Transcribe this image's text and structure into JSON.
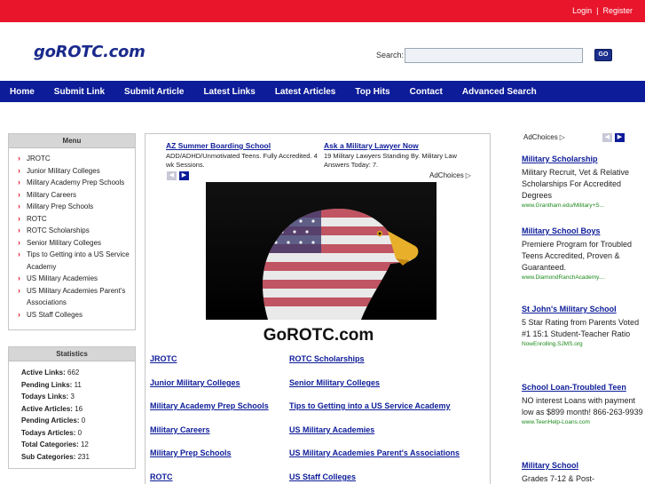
{
  "header": {
    "login_label": "Login",
    "separator": "|",
    "register_label": "Register",
    "logo_text": "goROTC.com",
    "search_label": "Search:",
    "search_value": "",
    "search_button_label": "GO"
  },
  "nav": {
    "items": [
      "Home",
      "Submit Link",
      "Submit Article",
      "Latest Links",
      "Latest Articles",
      "Top Hits",
      "Contact",
      "Advanced Search"
    ]
  },
  "menu": {
    "title": "Menu",
    "items": [
      "JROTC",
      "Junior Military Colleges",
      "Military Academy Prep Schools",
      "Military Careers",
      "Military Prep Schools",
      "ROTC",
      "ROTC Scholarships",
      "Senior Military Colleges",
      "Tips to Getting into a US Service Academy",
      "US Military Academies",
      "US Military Academies Parent's Associations",
      "US Staff Colleges"
    ]
  },
  "stats": {
    "title": "Statistics",
    "rows": [
      {
        "label": "Active Links:",
        "value": "662"
      },
      {
        "label": "Pending Links:",
        "value": "11"
      },
      {
        "label": "Todays Links:",
        "value": "3"
      },
      {
        "label": "Active Articles:",
        "value": "16"
      },
      {
        "label": "Pending Articles:",
        "value": "0"
      },
      {
        "label": "Todays Articles:",
        "value": "0"
      },
      {
        "label": "Total Categories:",
        "value": "12"
      },
      {
        "label": "Sub Categories:",
        "value": "231"
      }
    ]
  },
  "center_ads": {
    "ad1_title": "AZ Summer Boarding School",
    "ad1_text": "ADD/ADHD/Unmotivated Teens. Fully Accredited. 4 wk Sessions.",
    "ad2_title": "Ask a Military Lawyer Now",
    "ad2_text": "19 Military Lawyers Standing By. Military Law Answers Today: 7.",
    "adchoices_label": "AdChoices",
    "prev_arrow": "◀",
    "next_arrow": "▶"
  },
  "main": {
    "site_title": "GoROTC.com",
    "hero_icon": "eagle-flag-image"
  },
  "categories": {
    "left": [
      "JROTC",
      "Junior Military Colleges",
      "Military Academy Prep Schools",
      "Military Careers",
      "Military Prep Schools",
      "ROTC"
    ],
    "right": [
      "ROTC Scholarships",
      "Senior Military Colleges",
      "Tips to Getting into a US Service Academy",
      "US Military Academies",
      "US Military Academies Parent's Associations",
      "US Staff Colleges"
    ]
  },
  "right_ads": {
    "adchoices_label": "AdChoices",
    "ads": [
      {
        "title": "Military Scholarship",
        "text": "Military Recruit, Vet & Relative Scholarships For Accredited Degrees",
        "url": "www.Grantham.edu/Military+S..."
      },
      {
        "title": "Military School Boys",
        "text": "Premiere Program for Troubled Teens Accredited, Proven & Guaranteed.",
        "url": "www.DiamondRanchAcademy...."
      },
      {
        "title": "St John's Military School",
        "text": "5 Star Rating from Parents Voted #1 15:1 Student-Teacher Ratio",
        "url": "NowEnrolling.SJMS.org"
      },
      {
        "title": "School Loan-Troubled Teen",
        "text": "NO interest Loans with payment low as $899 month! 866-263-9939",
        "url": "www.TeenHelp-Loans.com"
      },
      {
        "title": "Military School",
        "text": "Grades 7-12 & Post-",
        "url": ""
      }
    ]
  },
  "colors": {
    "topbar": "#e8152b",
    "navbar": "#0d1c98",
    "link": "#0d1c98",
    "ad_url": "#1a8a1a"
  }
}
